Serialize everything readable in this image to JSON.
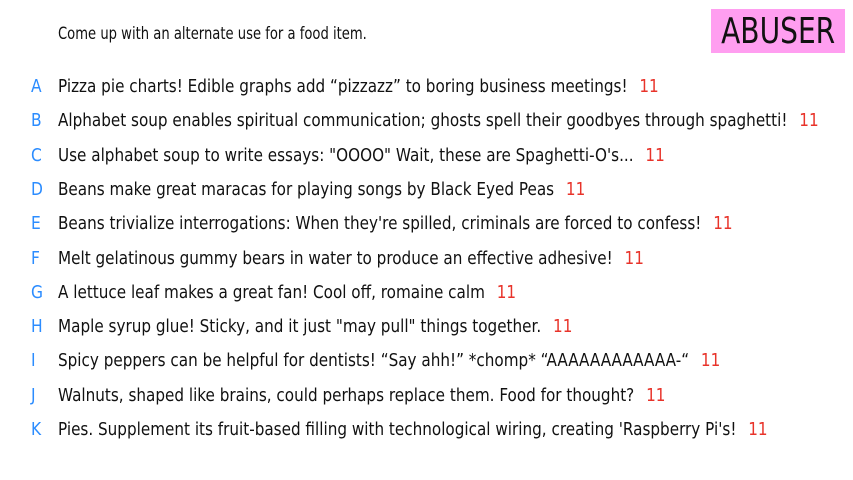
{
  "prompt": "Come up with an alternate use for a food item.",
  "badge": {
    "label": "ABUSER",
    "color": "#ff9ef0"
  },
  "colors": {
    "letter": "#2b8cff",
    "score": "#e8332a"
  },
  "answers": [
    {
      "letter": "A",
      "text": "Pizza pie charts! Edible graphs add “pizzazz” to boring business meetings!",
      "score": "11"
    },
    {
      "letter": "B",
      "text": "Alphabet soup enables spiritual communication; ghosts spell their goodbyes through spaghetti!",
      "score": "11"
    },
    {
      "letter": "C",
      "text": "Use alphabet soup to write essays: \"OOOO\" Wait, these are Spaghetti-O's...",
      "score": "11"
    },
    {
      "letter": "D",
      "text": "Beans make great maracas for playing songs by Black Eyed Peas",
      "score": "11"
    },
    {
      "letter": "E",
      "text": "Beans trivialize interrogations: When they're spilled, criminals are forced to confess!",
      "score": "11"
    },
    {
      "letter": "F",
      "text": "Melt gelatinous gummy bears in water to produce an effective adhesive!",
      "score": "11"
    },
    {
      "letter": "G",
      "text": "A lettuce leaf makes a great fan! Cool off, romaine calm",
      "score": "11"
    },
    {
      "letter": "H",
      "text": "Maple syrup glue! Sticky, and it just \"may pull\" things together.",
      "score": "11"
    },
    {
      "letter": "I",
      "text": "Spicy peppers can be helpful for dentists! “Say ahh!” *chomp* “AAAAAAAAAAAA-“",
      "score": "11"
    },
    {
      "letter": "J",
      "text": "Walnuts, shaped like brains, could perhaps replace them. Food for thought?",
      "score": "11"
    },
    {
      "letter": "K",
      "text": "Pies. Supplement its fruit-based filling with technological wiring, creating 'Raspberry Pi's!",
      "score": "11"
    }
  ]
}
